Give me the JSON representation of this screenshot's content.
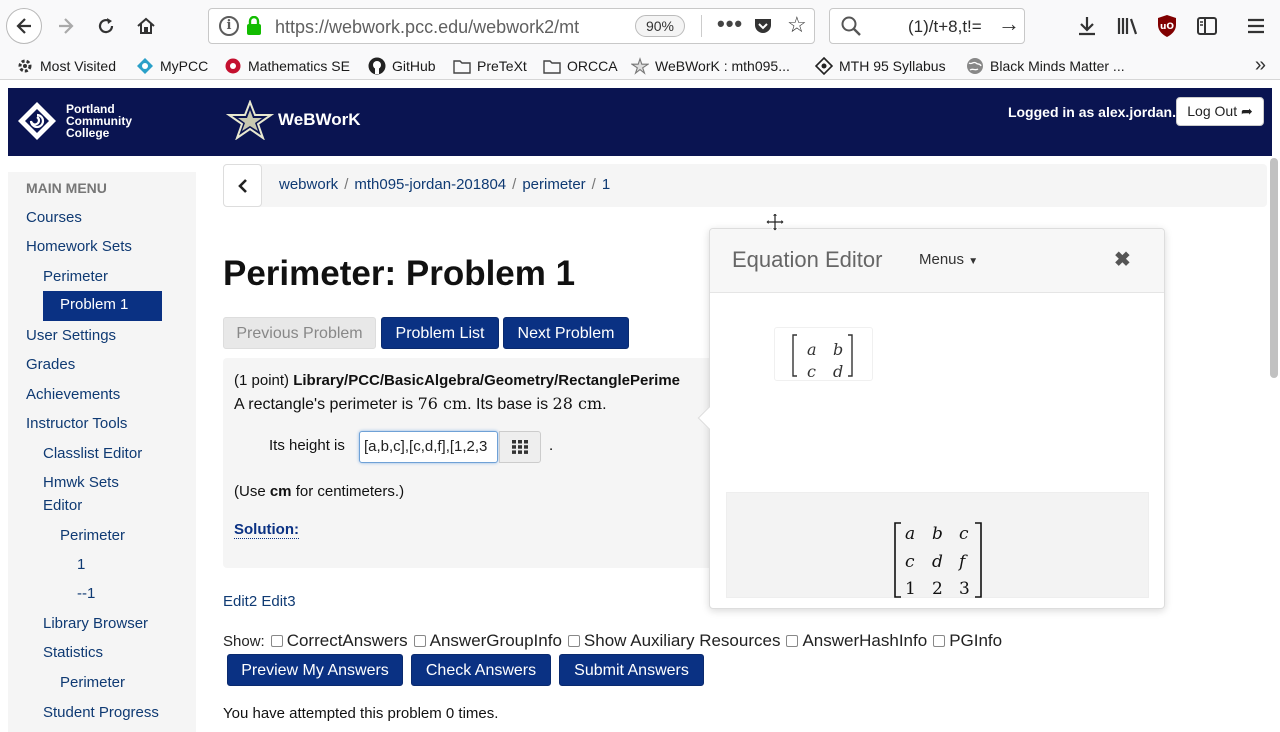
{
  "browser": {
    "url": "https://webwork.pcc.edu/webwork2/mt",
    "zoom": "90%",
    "search_text": "(1)/t+8,t!="
  },
  "bookmarks": [
    {
      "label": "Most Visited"
    },
    {
      "label": "MyPCC"
    },
    {
      "label": "Mathematics SE"
    },
    {
      "label": "GitHub"
    },
    {
      "label": "PreTeXt"
    },
    {
      "label": "ORCCA"
    },
    {
      "label": "WeBWorK : mth095..."
    },
    {
      "label": "MTH 95 Syllabus"
    },
    {
      "label": "Black Minds Matter ..."
    }
  ],
  "header": {
    "college": [
      "Portland",
      "Community",
      "College"
    ],
    "app_name": "WeBWorK",
    "logged_in": "Logged in as alex.jordan.",
    "logout_label": "Log Out"
  },
  "sidebar": {
    "heading": "MAIN MENU",
    "items": [
      "Courses",
      "Homework Sets",
      "Perimeter",
      "Problem 1",
      "User Settings",
      "Grades",
      "Achievements",
      "Instructor Tools",
      "Classlist Editor",
      "Hmwk Sets",
      "Editor",
      "Perimeter",
      "1",
      "--1",
      "Library Browser",
      "Statistics",
      "Perimeter",
      "Student Progress"
    ]
  },
  "breadcrumb": [
    "webwork",
    "mth095-jordan-201804",
    "perimeter",
    "1"
  ],
  "main": {
    "title": "Perimeter: Problem 1",
    "prev_label": "Previous Problem",
    "list_label": "Problem List",
    "next_label": "Next Problem",
    "points": "(1 point)",
    "library_path": "Library/PCC/BasicAlgebra/Geometry/RectanglePerime",
    "statement_a": "A rectangle's perimeter is ",
    "statement_b": "76 cm",
    "statement_c": ". Its base is ",
    "statement_d": "28 cm",
    "statement_e": ".",
    "height_label": "Its height is",
    "answer_value": "[a,b,c],[c,d,f],[1,2,3",
    "period": ".",
    "use_a": "(Use ",
    "use_b": "cm",
    "use_c": " for centimeters.)",
    "solution_label": "Solution:",
    "edit_links": "Edit2 Edit3",
    "show_label": "Show:",
    "show_options": [
      "CorrectAnswers",
      "AnswerGroupInfo",
      "Show Auxiliary Resources",
      "AnswerHashInfo",
      "PGInfo"
    ],
    "preview_label": "Preview My Answers",
    "check_label": "Check Answers",
    "submit_label": "Submit Answers",
    "attempts": "You have attempted this problem 0 times."
  },
  "equation_editor": {
    "title": "Equation Editor",
    "menus_label": "Menus",
    "close": "✖",
    "input_matrix": [
      [
        "a",
        "b"
      ],
      [
        "c",
        "d"
      ]
    ],
    "preview_matrix": [
      [
        "a",
        "b",
        "c"
      ],
      [
        "c",
        "d",
        "f"
      ],
      [
        "1",
        "2",
        "3"
      ]
    ]
  },
  "colors": {
    "header_bg": "#0a1451",
    "primary": "#0a3183",
    "link": "#0f3a73"
  }
}
